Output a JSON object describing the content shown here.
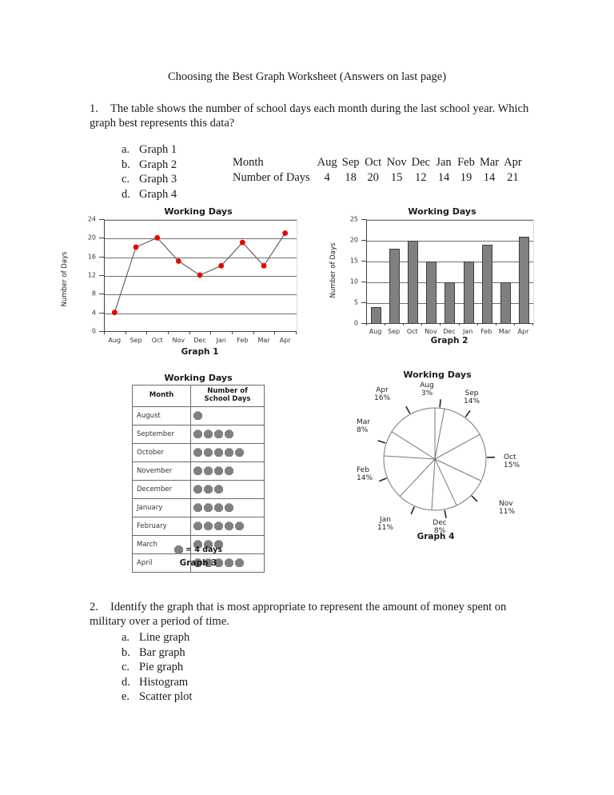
{
  "document": {
    "title": "Choosing the Best Graph Worksheet (Answers on last page)"
  },
  "questions": [
    {
      "number": "1.",
      "text": "The table shows the number of school days each month during the last school year. Which graph best represents this data?",
      "choices": [
        {
          "mark": "a.",
          "label": "Graph 1"
        },
        {
          "mark": "b.",
          "label": "Graph 2"
        },
        {
          "mark": "c.",
          "label": "Graph 3"
        },
        {
          "mark": "d.",
          "label": "Graph 4"
        }
      ]
    },
    {
      "number": "2.",
      "text": "Identify the graph that is most appropriate to represent the amount of money spent on military over a period of time.",
      "choices": [
        {
          "mark": "a.",
          "label": "Line graph"
        },
        {
          "mark": "b.",
          "label": "Bar graph"
        },
        {
          "mark": "c.",
          "label": "Pie graph"
        },
        {
          "mark": "d.",
          "label": "Histogram"
        },
        {
          "mark": "e.",
          "label": "Scatter plot"
        }
      ]
    }
  ],
  "data_table": {
    "row_headers": [
      "Month",
      "Number of Days"
    ],
    "months": [
      "Aug",
      "Sep",
      "Oct",
      "Nov",
      "Dec",
      "Jan",
      "Feb",
      "Mar",
      "Apr"
    ],
    "days": [
      "4",
      "18",
      "20",
      "15",
      "12",
      "14",
      "19",
      "14",
      "21"
    ]
  },
  "chart_data": [
    {
      "id": "graph1",
      "type": "line",
      "title": "Working Days",
      "caption": "Graph 1",
      "xlabel": "",
      "ylabel": "Number of Days",
      "categories": [
        "Aug",
        "Sep",
        "Oct",
        "Nov",
        "Dec",
        "Jan",
        "Feb",
        "Mar",
        "Apr"
      ],
      "values": [
        4,
        18,
        20,
        15,
        12,
        14,
        19,
        14,
        21
      ],
      "ylim": [
        0,
        24
      ],
      "yticks": [
        0,
        4,
        8,
        12,
        16,
        20,
        24
      ],
      "grid": true,
      "marker_color": "#ee0000",
      "line_color": "#666666",
      "legend": "none"
    },
    {
      "id": "graph2",
      "type": "bar",
      "title": "Working Days",
      "caption": "Graph 2",
      "xlabel": "",
      "ylabel": "Number of Days",
      "categories": [
        "Aug",
        "Sep",
        "Oct",
        "Nov",
        "Dec",
        "Jan",
        "Feb",
        "Mar",
        "Apr"
      ],
      "values": [
        4,
        18,
        20,
        15,
        10,
        15,
        19,
        10,
        21
      ],
      "ylim": [
        0,
        25
      ],
      "yticks": [
        0,
        5,
        10,
        15,
        20,
        25
      ],
      "grid": true,
      "bar_color": "#808080",
      "legend": "none"
    },
    {
      "id": "graph3",
      "type": "table",
      "title": "Working Days",
      "caption": "Graph 3",
      "columns": [
        "Month",
        "Number of School Days"
      ],
      "rows": [
        {
          "month": "August",
          "icons": 1
        },
        {
          "month": "September",
          "icons": 4
        },
        {
          "month": "October",
          "icons": 5
        },
        {
          "month": "November",
          "icons": 4
        },
        {
          "month": "December",
          "icons": 3
        },
        {
          "month": "January",
          "icons": 4
        },
        {
          "month": "February",
          "icons": 5
        },
        {
          "month": "March",
          "icons": 3
        },
        {
          "month": "April",
          "icons": 5
        }
      ],
      "key_text": "= 4 days",
      "icon_color": "#808080",
      "legend": "bottom"
    },
    {
      "id": "graph4",
      "type": "pie",
      "title": "Working Days",
      "caption": "Graph 4",
      "labels": [
        "Aug",
        "Sep",
        "Oct",
        "Nov",
        "Dec",
        "Jan",
        "Feb",
        "Mar",
        "Apr"
      ],
      "percents": [
        3,
        14,
        15,
        11,
        8,
        11,
        14,
        8,
        16
      ],
      "slice_labels": [
        {
          "name": "Aug",
          "pct": "3%"
        },
        {
          "name": "Sep",
          "pct": "14%"
        },
        {
          "name": "Oct",
          "pct": "15%"
        },
        {
          "name": "Nov",
          "pct": "11%"
        },
        {
          "name": "Dec",
          "pct": "8%"
        },
        {
          "name": "Jan",
          "pct": "11%"
        },
        {
          "name": "Feb",
          "pct": "14%"
        },
        {
          "name": "Mar",
          "pct": "8%"
        },
        {
          "name": "Apr",
          "pct": "16%"
        }
      ],
      "slice_color": "#ffffff",
      "outline_color": "#777777",
      "legend": "labels-outside"
    }
  ]
}
